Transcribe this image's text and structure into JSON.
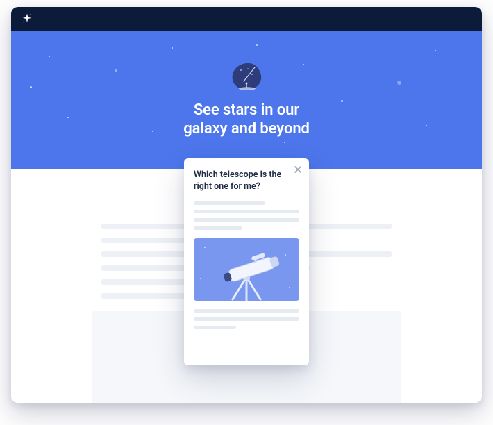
{
  "titlebar": {
    "icon": "sparkle-icon"
  },
  "hero": {
    "headline_line1": "See stars in our",
    "headline_line2": "galaxy and beyond",
    "accent_color": "#4d76ec"
  },
  "card": {
    "title": "Which telescope is the right one for me?",
    "close_label": "Close"
  }
}
